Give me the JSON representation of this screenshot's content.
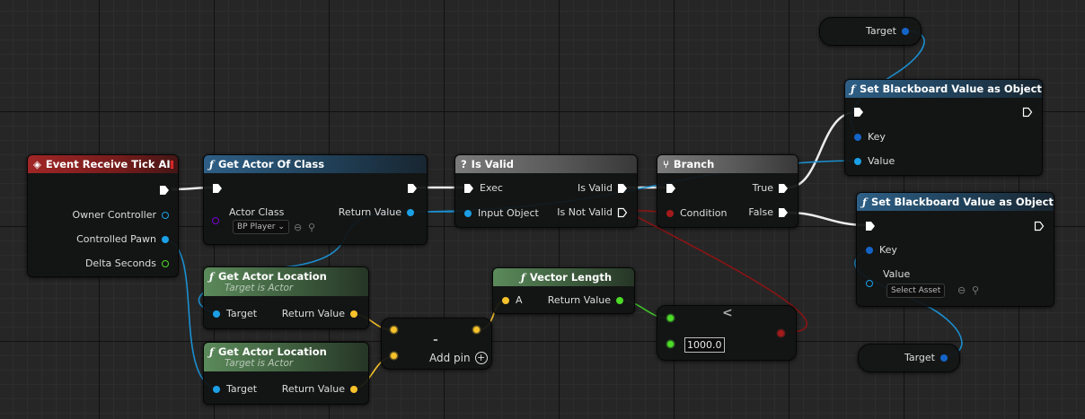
{
  "nodes": {
    "event_tick": {
      "title": "Event Receive Tick AI",
      "pins": [
        "Owner Controller",
        "Controlled Pawn",
        "Delta Seconds"
      ]
    },
    "get_actor_of_class": {
      "title": "Get Actor Of Class",
      "in_label": "Actor Class",
      "class_value": "BP Player",
      "out_label": "Return Value"
    },
    "is_valid": {
      "title": "Is Valid",
      "exec": "Exec",
      "is_valid": "Is Valid",
      "input_object": "Input Object",
      "is_not_valid": "Is Not Valid"
    },
    "branch": {
      "title": "Branch",
      "condition": "Condition",
      "true": "True",
      "false": "False"
    },
    "set_bb_1": {
      "title": "Set Blackboard Value as Object",
      "key": "Key",
      "value": "Value"
    },
    "set_bb_2": {
      "title": "Set Blackboard Value as Object",
      "key": "Key",
      "value": "Value",
      "asset_value": "Select Asset"
    },
    "get_loc_1": {
      "title": "Get Actor Location",
      "subtitle": "Target is Actor",
      "target": "Target",
      "ret": "Return Value"
    },
    "get_loc_2": {
      "title": "Get Actor Location",
      "subtitle": "Target is Actor",
      "target": "Target",
      "ret": "Return Value"
    },
    "subtract": {
      "symbol": "-",
      "add_pin": "Add pin"
    },
    "vector_length": {
      "title": "Vector Length",
      "a": "A",
      "ret": "Return Value"
    },
    "less": {
      "symbol": "<",
      "value": "1000.0"
    },
    "target_var_1": {
      "label": "Target"
    },
    "target_var_2": {
      "label": "Target"
    }
  },
  "colors": {
    "exec": "#ffffff",
    "object": "#1ba0e6",
    "vector": "#f7c22b",
    "float": "#4ddc28",
    "bool": "#a41a1a",
    "class": "#7a00d6"
  },
  "icons": {
    "event": "event-diamond-icon",
    "function": "function-f-icon",
    "is_valid": "question-mark-icon",
    "branch": "branch-icon"
  }
}
